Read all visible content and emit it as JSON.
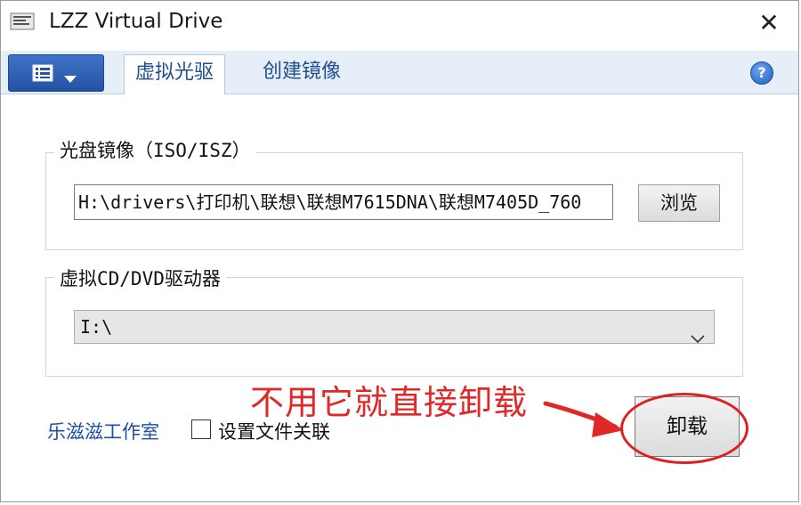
{
  "window": {
    "title": "LZZ Virtual Drive",
    "close_glyph": "✕"
  },
  "ribbon": {
    "menu_icon": "document-list-icon",
    "tabs": [
      {
        "label": "虚拟光驱",
        "active": true
      },
      {
        "label": "创建镜像",
        "active": false
      }
    ],
    "help_glyph": "?"
  },
  "image_group": {
    "legend": "光盘镜像（ISO/ISZ）",
    "path_value": "H:\\drivers\\打印机\\联想\\联想M7615DNA\\联想M7405D_760",
    "browse_label": "浏览"
  },
  "drive_group": {
    "legend": "虚拟CD/DVD驱动器",
    "selected_drive": "I:\\"
  },
  "footer": {
    "studio_link": "乐滋滋工作室",
    "file_assoc_label": "设置文件关联",
    "file_assoc_checked": false,
    "unmount_label": "卸载"
  },
  "annotation": {
    "text": "不用它就直接卸载",
    "color": "#e12828"
  }
}
